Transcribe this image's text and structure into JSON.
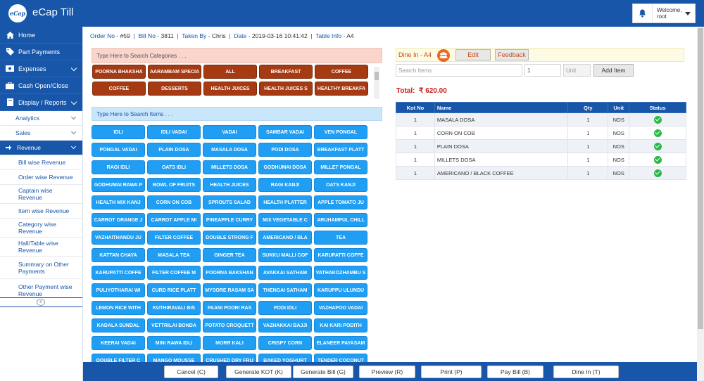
{
  "app": {
    "logo_text": "eCap",
    "title": "eCap Till"
  },
  "user": {
    "line1": "Welcome,",
    "line2": "root"
  },
  "sidebar": {
    "main": [
      {
        "label": "Home",
        "icon": "home-icon"
      },
      {
        "label": "Part Payments",
        "icon": "tag-icon"
      },
      {
        "label": "Expenses",
        "icon": "money-icon",
        "chevron": true
      },
      {
        "label": "Cash Open/Close",
        "icon": "briefcase-icon"
      },
      {
        "label": "Display / Reports",
        "icon": "book-icon",
        "chevron": true
      }
    ],
    "sub": [
      {
        "label": "Analytics"
      },
      {
        "label": "Sales"
      },
      {
        "label": "Revenue",
        "active": true
      }
    ],
    "revenue_items": [
      "Bill wise Revenue",
      "Order wise Revenue",
      "Captain wise Revenue",
      "Item wise Revenue",
      "Category wise Revenue",
      "Hall/Table wise Revenue",
      "Summary on Other Payments",
      "Other Payment wise Revenue"
    ],
    "collapse_symbol": "«"
  },
  "info": {
    "order_label": "Order No - ",
    "order_value": "#59",
    "bill_label": "Bill No - ",
    "bill_value": "3811",
    "taken_label": "Taken By - ",
    "taken_value": "Chris",
    "date_label": "Date - ",
    "date_value": "2019-03-16 10:41:42",
    "table_label": "Table Info - ",
    "table_value": "A4"
  },
  "categories": {
    "search_placeholder": "Type Here to Search Categories . . .",
    "items": [
      "POORNA BHAKSHA",
      "AARAMBAM SPECIA",
      "ALL",
      "BREAKFAST",
      "COFFEE",
      "COFFEE",
      "DESSERTS",
      "HEALTH JUICES",
      "HEALTH JUICES S",
      "HEALTHY BREAKFA"
    ]
  },
  "items": {
    "search_placeholder": "Type Here to Search Items . . .",
    "list": [
      "IDLI",
      "IDLI VADAI",
      "VADAI",
      "SAMBAR VADAI",
      "VEN PONGAL",
      "PONGAL VADAI",
      "PLAIN DOSA",
      "MASALA DOSA",
      "PODI DOSA",
      "BREAKFAST PLATT",
      "RAGI IDLI",
      "OATS IDLI",
      "MILLETS DOSA",
      "GODHUMAI DOSA",
      "MILLET PONGAL",
      "GODHUMAI RAWA P",
      "BOWL OF FRUITS",
      "HEALTH JUICES",
      "RAGI KANJI",
      "OATS KANJI",
      "HEALTH MIX KANJ",
      "CORN ON COB",
      "SPROUTS SALAD",
      "HEALTH PLATTER",
      "APPLE TOMATO JU",
      "CARROT ORANGE J",
      "CARROT APPLE MI",
      "PINEAPPLE CURRY",
      "MIX VEGETABLE C",
      "ARUHAMPUL CHILL",
      "VAZHAITHANDU JU",
      "FILTER COFFEE",
      "DOUBLE STRONG F",
      "AMERICANO / BLA",
      "TEA",
      "KATTAN CHAYA",
      "MASALA TEA",
      "GINGER TEA",
      "SUKKU MALLI COF",
      "KARUPATTI COFFE",
      "KARUPATTI COFFE",
      "FILTER COFFEE M",
      "POORNA BAKSHAN",
      "AVAKKAI SATHAM",
      "VATHAKOZHAMBU S",
      "PULIYOTHARAI WI",
      "CURD RICE PLATT",
      "MYSORE RASAM SA",
      "THENGAI SATHAM",
      "KARUPPU ULUNDU",
      "LEMON RICE WITH",
      "KUTHIRAVALI BIS",
      "PAANI POORI RAS",
      "PODI IDLI",
      "VAZHAPOO VADAI",
      "KADALA SUNDAL",
      "VETTRILAI BONDA",
      "POTATO CROQUETT",
      "VAZHAKKAI BAJJI",
      "KAI KARI PODITH",
      "KEERAI VADAI",
      "MINI RAWA IDLI",
      "MORR KALI",
      "CRISPY CORN",
      "ELANEER PAYASAM",
      "DOUBLE FILTER C",
      "MANGO MOUSSE",
      "CRUSHED DRY FRU",
      "BAKED YOGHURT",
      "TENDER COCONUT"
    ]
  },
  "order": {
    "dine_label": "Dine In - A4",
    "edit_label": "Edit",
    "feedback_label": "Feedback",
    "search_items_placeholder": "Search Items",
    "qty_value": "1",
    "unit_placeholder": "Unit",
    "add_label": "Add Item",
    "total_label": "Total:",
    "total_value": "₹ 620.00",
    "columns": [
      "Kot No",
      "Name",
      "Qty",
      "Unit",
      "Status"
    ],
    "rows": [
      {
        "kot": "1",
        "name": "MASALA DOSA",
        "qty": "1",
        "unit": "NOS"
      },
      {
        "kot": "1",
        "name": "CORN ON COB",
        "qty": "1",
        "unit": "NOS"
      },
      {
        "kot": "1",
        "name": "PLAIN DOSA",
        "qty": "1",
        "unit": "NOS"
      },
      {
        "kot": "1",
        "name": "MILLETS DOSA",
        "qty": "1",
        "unit": "NOS"
      },
      {
        "kot": "1",
        "name": "AMERICANO / BLACK COFFEE",
        "qty": "1",
        "unit": "NOS"
      }
    ]
  },
  "actions": [
    "Cancel (C)",
    "Generate KOT (K)",
    "Generate Bill (G)",
    "Preview (R)",
    "Print (P)",
    "Pay Bill (B)",
    "Dine In (T)"
  ],
  "colors": {
    "primary": "#1756a9",
    "category": "#a63a12",
    "item": "#1f9ef3",
    "total": "#c8201a",
    "status_ok": "#2db84a"
  }
}
